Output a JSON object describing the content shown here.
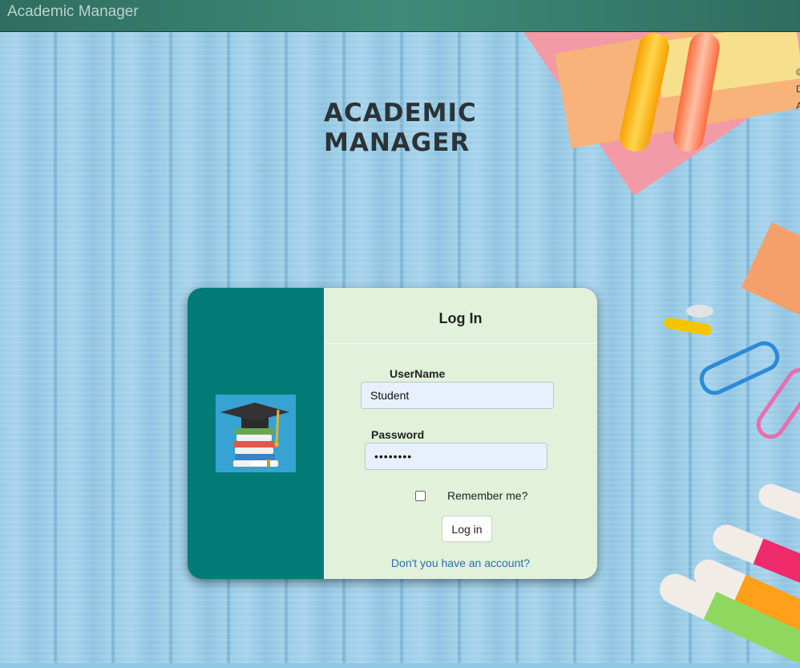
{
  "app": {
    "brand": "Academic Manager"
  },
  "hero": {
    "title_line1": "ACADEMIC",
    "title_line2": "MANAGER"
  },
  "corner_text": [
    "©",
    "D",
    "A"
  ],
  "login": {
    "title": "Log In",
    "username_label": "UserName",
    "username_value": "Student",
    "password_label": "Password",
    "password_value": "••••••••",
    "remember_label": "Remember me?",
    "remember_checked": false,
    "submit_label": "Log in",
    "register_link": "Don't you have an account?"
  },
  "colors": {
    "topbar": "#3f8a78",
    "card_left": "#027b77",
    "card_right": "#e1f1da",
    "link": "#2a6db5"
  },
  "icons": {
    "logo": "graduation-cap-books-icon"
  }
}
